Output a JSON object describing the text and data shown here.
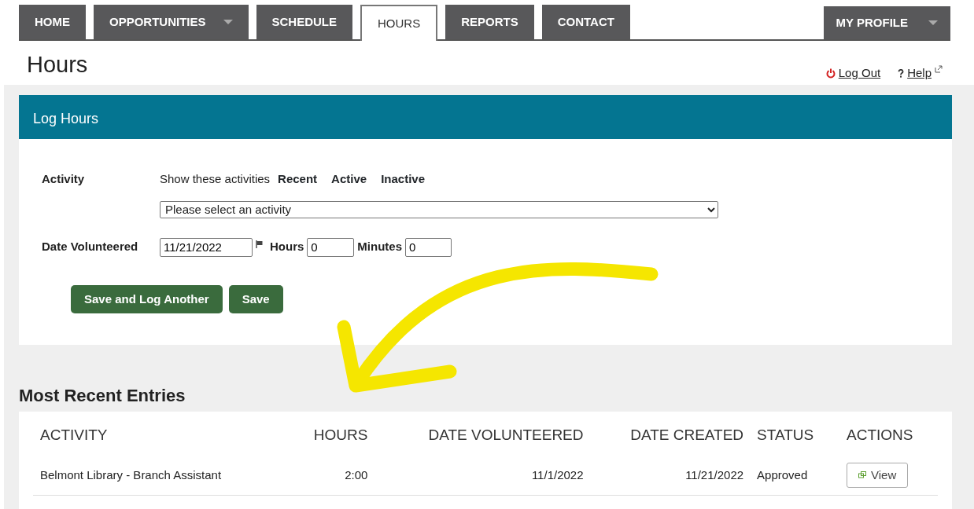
{
  "tabs": [
    {
      "label": "HOME",
      "selected": false,
      "has_menu": false
    },
    {
      "label": "OPPORTUNITIES",
      "selected": false,
      "has_menu": true
    },
    {
      "label": "SCHEDULE",
      "selected": false,
      "has_menu": false
    },
    {
      "label": "HOURS",
      "selected": true,
      "has_menu": false
    },
    {
      "label": "REPORTS",
      "selected": false,
      "has_menu": false
    },
    {
      "label": "CONTACT",
      "selected": false,
      "has_menu": false
    }
  ],
  "profile_menu": {
    "label": "MY PROFILE"
  },
  "page_title": "Hours",
  "header_links": [
    {
      "kind": "logout",
      "label": "Log Out"
    },
    {
      "kind": "help",
      "label": "Help"
    }
  ],
  "log_hours": {
    "title": "Log Hours",
    "activity_label": "Activity",
    "filter_label": "Show these activities",
    "filters": [
      "Recent",
      "Active",
      "Inactive"
    ],
    "activity_select": {
      "value": "Please select an activity"
    },
    "date_label": "Date Volunteered",
    "date_value": "11/21/2022",
    "hours_label": "Hours",
    "hours_value": "0",
    "minutes_label": "Minutes",
    "minutes_value": "0",
    "buttons": [
      "Save and Log Another",
      "Save"
    ]
  },
  "recent": {
    "title": "Most Recent Entries",
    "columns": [
      "ACTIVITY",
      "HOURS",
      "DATE VOLUNTEERED",
      "DATE CREATED",
      "STATUS",
      "ACTIONS"
    ],
    "rows": [
      {
        "activity": "Belmont Library - Branch Assistant",
        "hours": "2:00",
        "date_volunteered": "11/1/2022",
        "date_created": "11/21/2022",
        "status": "Approved",
        "action": "View"
      }
    ]
  }
}
